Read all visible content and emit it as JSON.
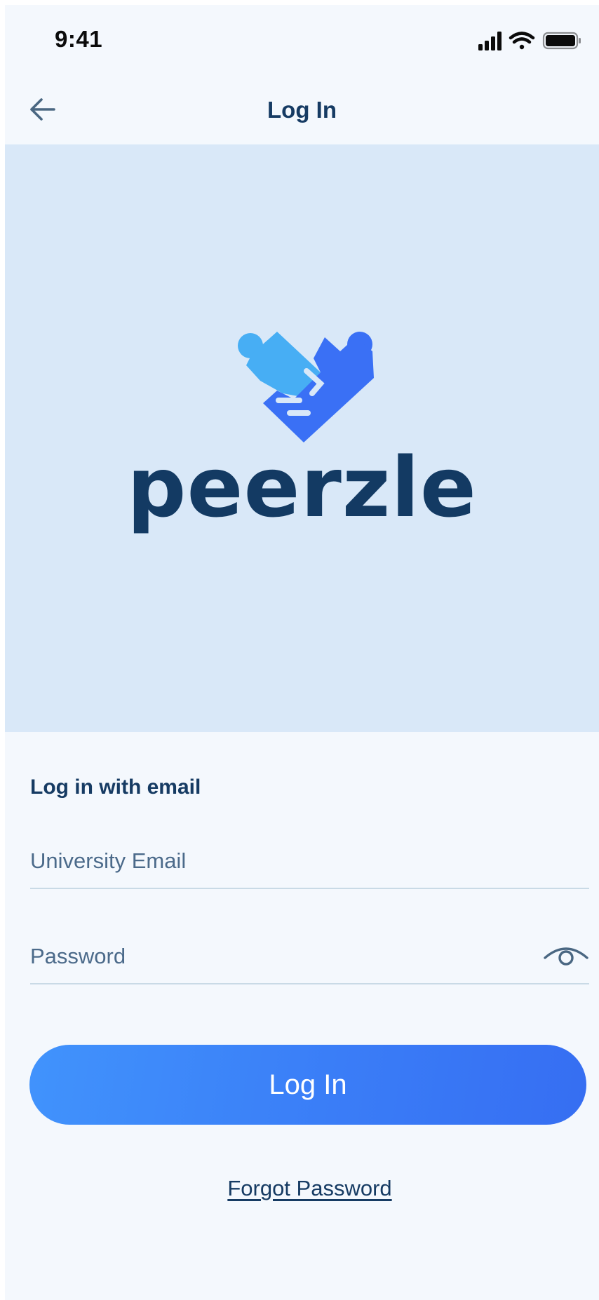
{
  "status_bar": {
    "time": "9:41",
    "icons": [
      "cellular-signal-icon",
      "wifi-icon",
      "battery-icon"
    ]
  },
  "nav": {
    "back_icon": "arrow-left-icon",
    "title": "Log In"
  },
  "hero": {
    "background": "#d9e8f8",
    "logo_icon": "puzzle-handshake-icon",
    "brand_name": "peerzle",
    "brand_color": "#133a63",
    "logo_colors": [
      "#47aef4",
      "#3a70f5"
    ]
  },
  "form": {
    "heading": "Log in with email",
    "email": {
      "value": "",
      "placeholder": "University Email"
    },
    "password": {
      "value": "",
      "placeholder": "Password",
      "toggle_icon": "eye-icon"
    },
    "submit_label": "Log In",
    "forgot_label": "Forgot Password"
  },
  "colors": {
    "primary_text": "#163b63",
    "button_gradient_start": "#4193fc",
    "button_gradient_end": "#366ef2",
    "page_background": "#f4f8fd"
  }
}
